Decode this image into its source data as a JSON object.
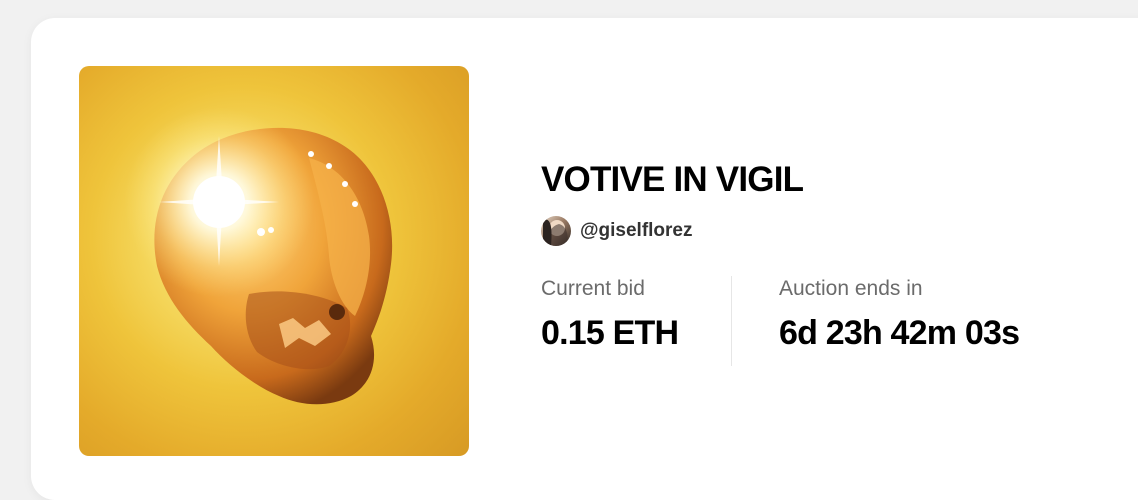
{
  "nft": {
    "title": "VOTIVE IN VIGIL",
    "creator_handle": "@giselflorez",
    "artwork_icon": "glowing-skull-artwork",
    "avatar_icon": "creator-avatar"
  },
  "stats": {
    "bid_label": "Current bid",
    "bid_value": "0.15 ETH",
    "auction_label": "Auction ends in",
    "auction_value": "6d 23h 42m 03s"
  },
  "colors": {
    "background": "#f1f1f1",
    "card": "#ffffff",
    "text_primary": "#000000",
    "text_secondary": "#6b6b6b",
    "artwork_gold": "#efc43b"
  }
}
